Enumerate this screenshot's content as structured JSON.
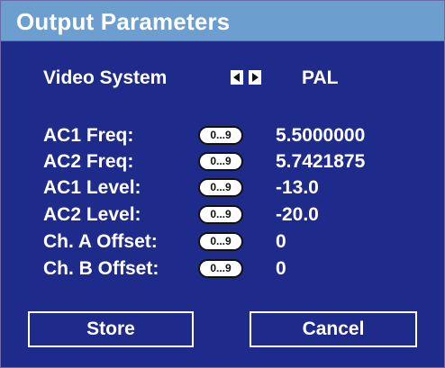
{
  "window": {
    "title": "Output Parameters"
  },
  "video_system": {
    "label": "Video System",
    "value": "PAL",
    "prev_icon": "triangle-left-icon",
    "next_icon": "triangle-right-icon"
  },
  "keypad_label": "0...9",
  "params": [
    {
      "label": "AC1 Freq:",
      "value": "5.5000000"
    },
    {
      "label": "AC2 Freq:",
      "value": "5.7421875"
    },
    {
      "label": "AC1 Level:",
      "value": "-13.0"
    },
    {
      "label": "AC2 Level:",
      "value": "-20.0"
    },
    {
      "label": "Ch. A Offset:",
      "value": "0"
    },
    {
      "label": "Ch. B Offset:",
      "value": "0"
    }
  ],
  "buttons": {
    "store": "Store",
    "cancel": "Cancel"
  },
  "colors": {
    "background": "#1f2b8a",
    "titlebar": "#6c9ed0",
    "text": "#ffffff"
  }
}
